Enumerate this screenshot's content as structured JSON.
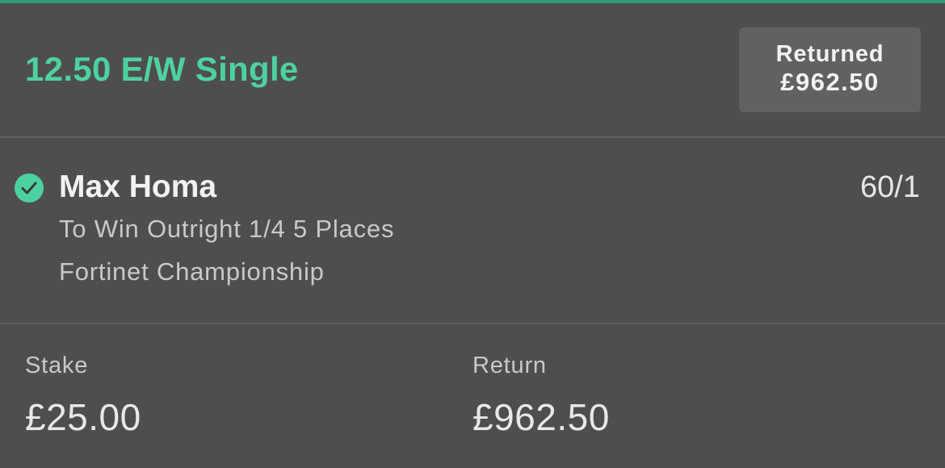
{
  "bet": {
    "title": "12.50 E/W Single",
    "status_label": "Returned",
    "status_amount": "£962.50"
  },
  "selection": {
    "icon": "check-circle-icon",
    "name": "Max Homa",
    "odds": "60/1",
    "market": "To Win Outright 1/4 5 Places",
    "event": "Fortinet Championship"
  },
  "summary": {
    "stake_label": "Stake",
    "stake_value": "£25.00",
    "return_label": "Return",
    "return_value": "£962.50"
  },
  "colors": {
    "accent": "#4ed1a0",
    "background": "#4e4e4e",
    "badge_background": "#616161"
  }
}
